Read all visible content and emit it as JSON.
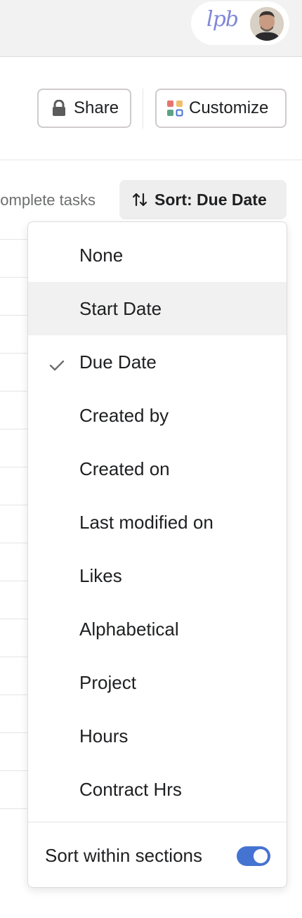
{
  "topbar": {
    "org_logo_text": "lpb",
    "avatar": "user-avatar-photo"
  },
  "header": {
    "share_label": "Share",
    "customize_label": "Customize",
    "lock_icon": "lock-icon",
    "customize_icon": "customize-grid-icon"
  },
  "toolbar": {
    "incomplete_label": "Incomplete tasks",
    "sort_label": "Sort: Due Date",
    "sort_icon": "sort-arrows-icon"
  },
  "sort_menu": {
    "items": [
      {
        "label": "None"
      },
      {
        "label": "Start Date"
      },
      {
        "label": "Due Date"
      },
      {
        "label": "Created by"
      },
      {
        "label": "Created on"
      },
      {
        "label": "Last modified on"
      },
      {
        "label": "Likes"
      },
      {
        "label": "Alphabetical"
      },
      {
        "label": "Project"
      },
      {
        "label": "Hours"
      },
      {
        "label": "Contract Hrs"
      }
    ],
    "selected": "Due Date",
    "hovered": "Start Date",
    "sort_within_sections_label": "Sort within sections",
    "sort_within_sections_on": true
  },
  "colors": {
    "accent": "#4573d2",
    "hover_bg": "#f1f1f1",
    "topbar_bg": "#f2f2f2"
  }
}
